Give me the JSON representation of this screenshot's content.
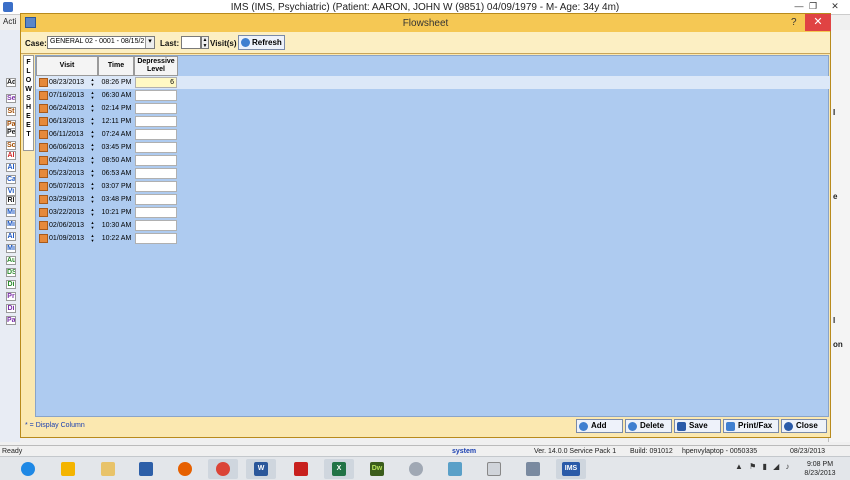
{
  "app": {
    "title": "IMS (IMS, Psychiatric)    (Patient: AARON, JOHN W (9851) 04/09/1979 - M- Age: 34y 4m)",
    "menu_first": "Acti",
    "min_glyph": "—",
    "restore_glyph": "❐",
    "close_glyph": "✕"
  },
  "left_strip_items": [
    "Ad",
    "Se",
    "St",
    "Pa",
    "Pe",
    "Sc",
    "Al",
    "Al",
    "Ca",
    "Vi",
    "Rl",
    "Mi",
    "Mi",
    "Al",
    "Mi",
    "Au",
    "DS",
    "Di",
    "Pr",
    "Di",
    "Pa"
  ],
  "right_strip_items": [
    "I",
    "e",
    "l",
    "on"
  ],
  "flowsheet": {
    "title": "Flowsheet",
    "help_glyph": "?",
    "close_glyph": "✕",
    "side_tab_letters": [
      "F",
      "L",
      "O",
      "W",
      "S",
      "H",
      "E",
      "E",
      "T"
    ],
    "toolbar": {
      "case_label": "Case:",
      "case_value": "GENERAL 02  -  0001 - 08/15/2",
      "case_arrow": "▾",
      "last_label": "Last:",
      "last_value": "",
      "visits_label": "Visit(s)",
      "refresh_label": "Refresh"
    },
    "columns": [
      "Visit",
      "Time",
      "Depressive Level"
    ],
    "rows": [
      {
        "date": "08/23/2013",
        "time": "08:26 PM",
        "level": "6"
      },
      {
        "date": "07/16/2013",
        "time": "06:30 AM",
        "level": ""
      },
      {
        "date": "06/24/2013",
        "time": "02:14 PM",
        "level": ""
      },
      {
        "date": "06/13/2013",
        "time": "12:11 PM",
        "level": ""
      },
      {
        "date": "06/11/2013",
        "time": "07:24 AM",
        "level": ""
      },
      {
        "date": "06/06/2013",
        "time": "03:45 PM",
        "level": ""
      },
      {
        "date": "05/24/2013",
        "time": "08:50 AM",
        "level": ""
      },
      {
        "date": "05/23/2013",
        "time": "06:53 AM",
        "level": ""
      },
      {
        "date": "05/07/2013",
        "time": "03:07 PM",
        "level": ""
      },
      {
        "date": "03/29/2013",
        "time": "03:48 PM",
        "level": ""
      },
      {
        "date": "03/22/2013",
        "time": "10:21 PM",
        "level": ""
      },
      {
        "date": "02/06/2013",
        "time": "10:30 AM",
        "level": ""
      },
      {
        "date": "01/09/2013",
        "time": "10:22 AM",
        "level": ""
      }
    ],
    "display_column_note": "* = Display Column",
    "buttons": {
      "add": "Add",
      "delete": "Delete",
      "save": "Save",
      "print_fax": "Print/Fax",
      "close": "Close"
    }
  },
  "statusbar": {
    "ready": "Ready",
    "user": "system",
    "version": "Ver. 14.0.0 Service Pack 1",
    "build": "Build: 091012",
    "machine": "hpenvylaptop - 0050335",
    "date": "08/23/2013"
  },
  "taskbar": {
    "apps": [
      "internet-explorer",
      "outlook",
      "file-explorer",
      "remote-desktop",
      "firefox",
      "chrome",
      "word",
      "acrobat",
      "excel",
      "dreamweaver",
      "paint",
      "mail",
      "calculator",
      "snipping-tool",
      "ims"
    ],
    "dw_label": "Dw",
    "ims_label": "IMS",
    "word_label": "W",
    "excel_label": "X",
    "clock_time": "9:08 PM",
    "clock_date": "8/23/2013"
  }
}
